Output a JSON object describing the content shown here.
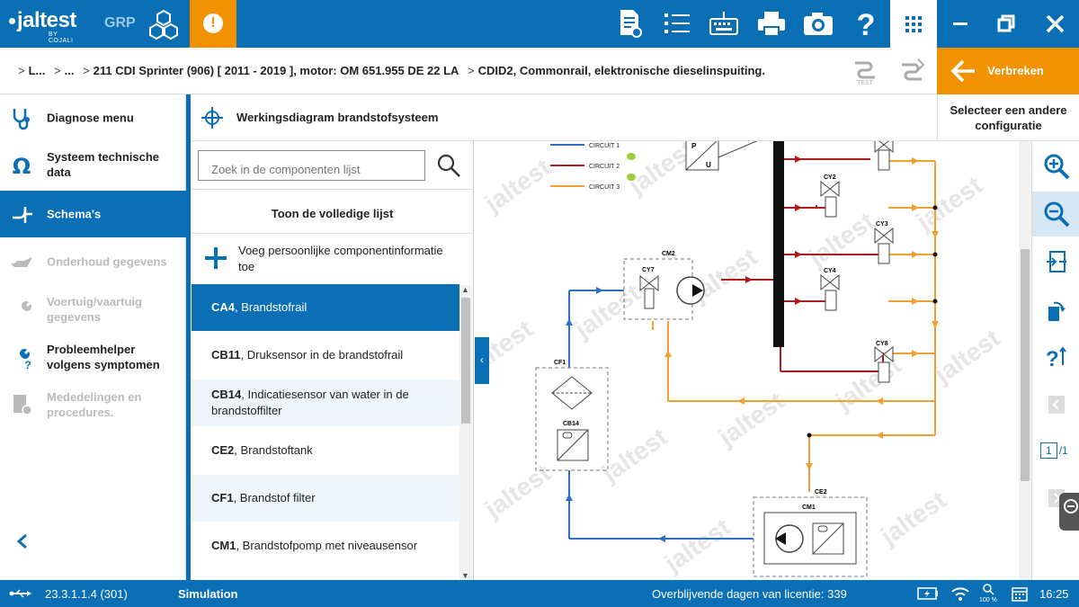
{
  "app": {
    "logo": "jaltest",
    "logo_sub": "BY COJALI",
    "grp": "GRP"
  },
  "breadcrumb": {
    "items": [
      "L...",
      "...",
      "211 CDI Sprinter (906) [ 2011 - 2019 ], motor: OM 651.955 DE 22 LA",
      "CDID2, Commonrail, elektronische dieselinspuiting."
    ],
    "back_label": "Verbreken"
  },
  "test_icons": {
    "test_label": "TEST"
  },
  "sidebar": {
    "items": [
      {
        "label": "Diagnose menu",
        "icon": "diagnosis-icon",
        "state": "normal"
      },
      {
        "label": "Systeem technische data",
        "icon": "omega-icon",
        "state": "normal"
      },
      {
        "label": "Schema's",
        "icon": "schema-icon",
        "state": "active"
      },
      {
        "label": "Onderhoud gegevens",
        "icon": "oilcan-icon",
        "state": "disabled"
      },
      {
        "label": "Voertuig/vaartuig gegevens",
        "icon": "wrench-icon",
        "state": "disabled"
      },
      {
        "label": "Probleemhelper volgens symptomen",
        "icon": "tools-icon",
        "state": "normal"
      },
      {
        "label": "Mededelingen en procedures.",
        "icon": "document-icon",
        "state": "disabled"
      }
    ]
  },
  "panel": {
    "title": "Werkingsdiagram brandstofsysteem",
    "config_button": "Selecteer een andere configuratie"
  },
  "list": {
    "search_placeholder": "Zoek in de componenten lijst",
    "show_all": "Toon de volledige lijst",
    "add_info": "Voeg persoonlijke componentinformatie toe",
    "rows": [
      {
        "code": "CA4",
        "name": ", Brandstofrail"
      },
      {
        "code": "CB11",
        "name": ", Druksensor in de brandstofrail"
      },
      {
        "code": "CB14",
        "name": ", Indicatiesensor van water in de brandstoffilter"
      },
      {
        "code": "CE2",
        "name": ", Brandstoftank"
      },
      {
        "code": "CF1",
        "name": ", Brandstof filter"
      },
      {
        "code": "CM1",
        "name": ", Brandstofpomp met niveausensor"
      }
    ]
  },
  "diagram": {
    "legend": [
      {
        "label": "CIRCUIT 1",
        "color": "#2f6fc6"
      },
      {
        "label": "CIRCUIT 2",
        "color": "#b01c1c"
      },
      {
        "label": "CIRCUIT 3",
        "color": "#f0a030"
      }
    ],
    "labels": {
      "cm2": "CM2",
      "cy7": "CY7",
      "cy2": "CY2",
      "cy3": "CY3",
      "cy4": "CY4",
      "cy8": "CY8",
      "cf1": "CF1",
      "cb14": "CB14",
      "ce2": "CE2",
      "cm1": "CM1",
      "p": "P",
      "u": "U"
    },
    "watermark": "jaltest"
  },
  "page_indicator": {
    "current": "1",
    "total": "/1"
  },
  "status": {
    "version": "23.3.1.1.4 (301)",
    "mode": "Simulation",
    "license": "Overblijvende dagen van licentie: 339",
    "zoom": "100 %",
    "time": "16:25"
  }
}
